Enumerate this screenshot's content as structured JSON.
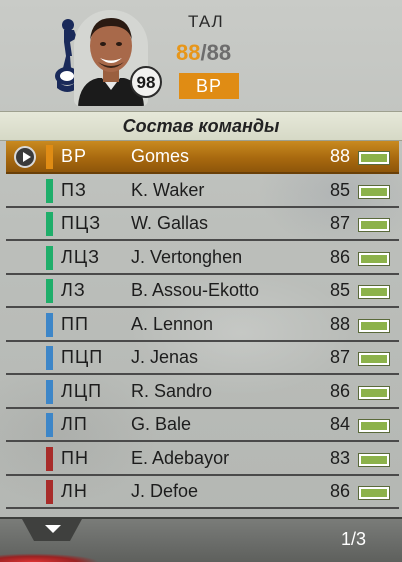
{
  "header": {
    "team_abbr": "ТАЛ",
    "rating_current": "88",
    "rating_separator": "/",
    "rating_max": "88",
    "overall_badge": "98",
    "position": "ВР",
    "club_crest_icon": "tottenham-crest-icon"
  },
  "section_title": "Состав команды",
  "colors": {
    "goalkeeper": "#e08c14",
    "defender": "#1fae6a",
    "midfielder": "#3d86c8",
    "forward": "#a82c2a",
    "selected_row": "#a8690f",
    "fitness": "#8cb24a"
  },
  "players": [
    {
      "pos": "ВР",
      "name": "Gomes",
      "rating": "88",
      "group": "goalkeeper",
      "selected": true
    },
    {
      "pos": "ПЗ",
      "name": "K. Waker",
      "rating": "85",
      "group": "defender"
    },
    {
      "pos": "ПЦЗ",
      "name": "W. Gallas",
      "rating": "87",
      "group": "defender"
    },
    {
      "pos": "ЛЦЗ",
      "name": "J. Vertonghen",
      "rating": "86",
      "group": "defender"
    },
    {
      "pos": "ЛЗ",
      "name": "B. Assou-Ekotto",
      "rating": "85",
      "group": "defender"
    },
    {
      "pos": "ПП",
      "name": "A. Lennon",
      "rating": "88",
      "group": "midfielder"
    },
    {
      "pos": "ПЦП",
      "name": "J. Jenas",
      "rating": "87",
      "group": "midfielder"
    },
    {
      "pos": "ЛЦП",
      "name": "R. Sandro",
      "rating": "86",
      "group": "midfielder"
    },
    {
      "pos": "ЛП",
      "name": "G. Bale",
      "rating": "84",
      "group": "midfielder"
    },
    {
      "pos": "ПН",
      "name": "E. Adebayor",
      "rating": "83",
      "group": "forward"
    },
    {
      "pos": "ЛН",
      "name": "J. Defoe",
      "rating": "86",
      "group": "forward"
    }
  ],
  "footer": {
    "page_indicator": "1/3",
    "scroll_icon": "chevron-down-icon"
  }
}
